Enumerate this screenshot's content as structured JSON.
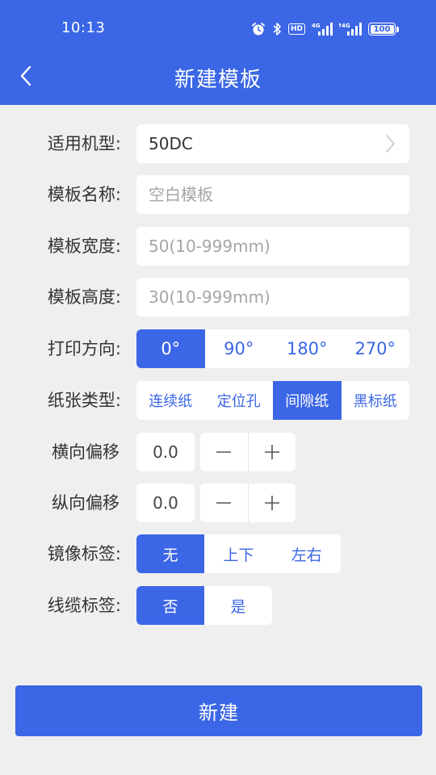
{
  "status_bar": {
    "time": "10:13",
    "hd_label": "HD",
    "network_1": "4G",
    "network_2": "4G",
    "battery_level": "100"
  },
  "header": {
    "title": "新建模板",
    "background_color": "#3b66e6"
  },
  "form": {
    "model": {
      "label": "适用机型:",
      "value": "50DC"
    },
    "name": {
      "label": "模板名称:",
      "placeholder": "空白模板"
    },
    "width": {
      "label": "模板宽度:",
      "placeholder": "50(10-999mm)"
    },
    "height": {
      "label": "模板高度:",
      "placeholder": "30(10-999mm)"
    },
    "print_direction": {
      "label": "打印方向:",
      "options": [
        "0°",
        "90°",
        "180°",
        "270°"
      ],
      "selected": "0°"
    },
    "paper_type": {
      "label": "纸张类型:",
      "options": [
        "连续纸",
        "定位孔",
        "间隙纸",
        "黑标纸"
      ],
      "selected": "间隙纸"
    },
    "horizontal_offset": {
      "label": "横向偏移",
      "value": "0.0"
    },
    "vertical_offset": {
      "label": "纵向偏移",
      "value": "0.0"
    },
    "mirror_label": {
      "label": "镜像标签:",
      "options": [
        "无",
        "上下",
        "左右"
      ],
      "selected": "无"
    },
    "cable_label": {
      "label": "线缆标签:",
      "options": [
        "否",
        "是"
      ],
      "selected": "否"
    }
  },
  "create_button": {
    "label": "新建"
  },
  "colors": {
    "accent": "#3b66e6",
    "background": "#efefef",
    "placeholder": "#a6a6a6"
  }
}
